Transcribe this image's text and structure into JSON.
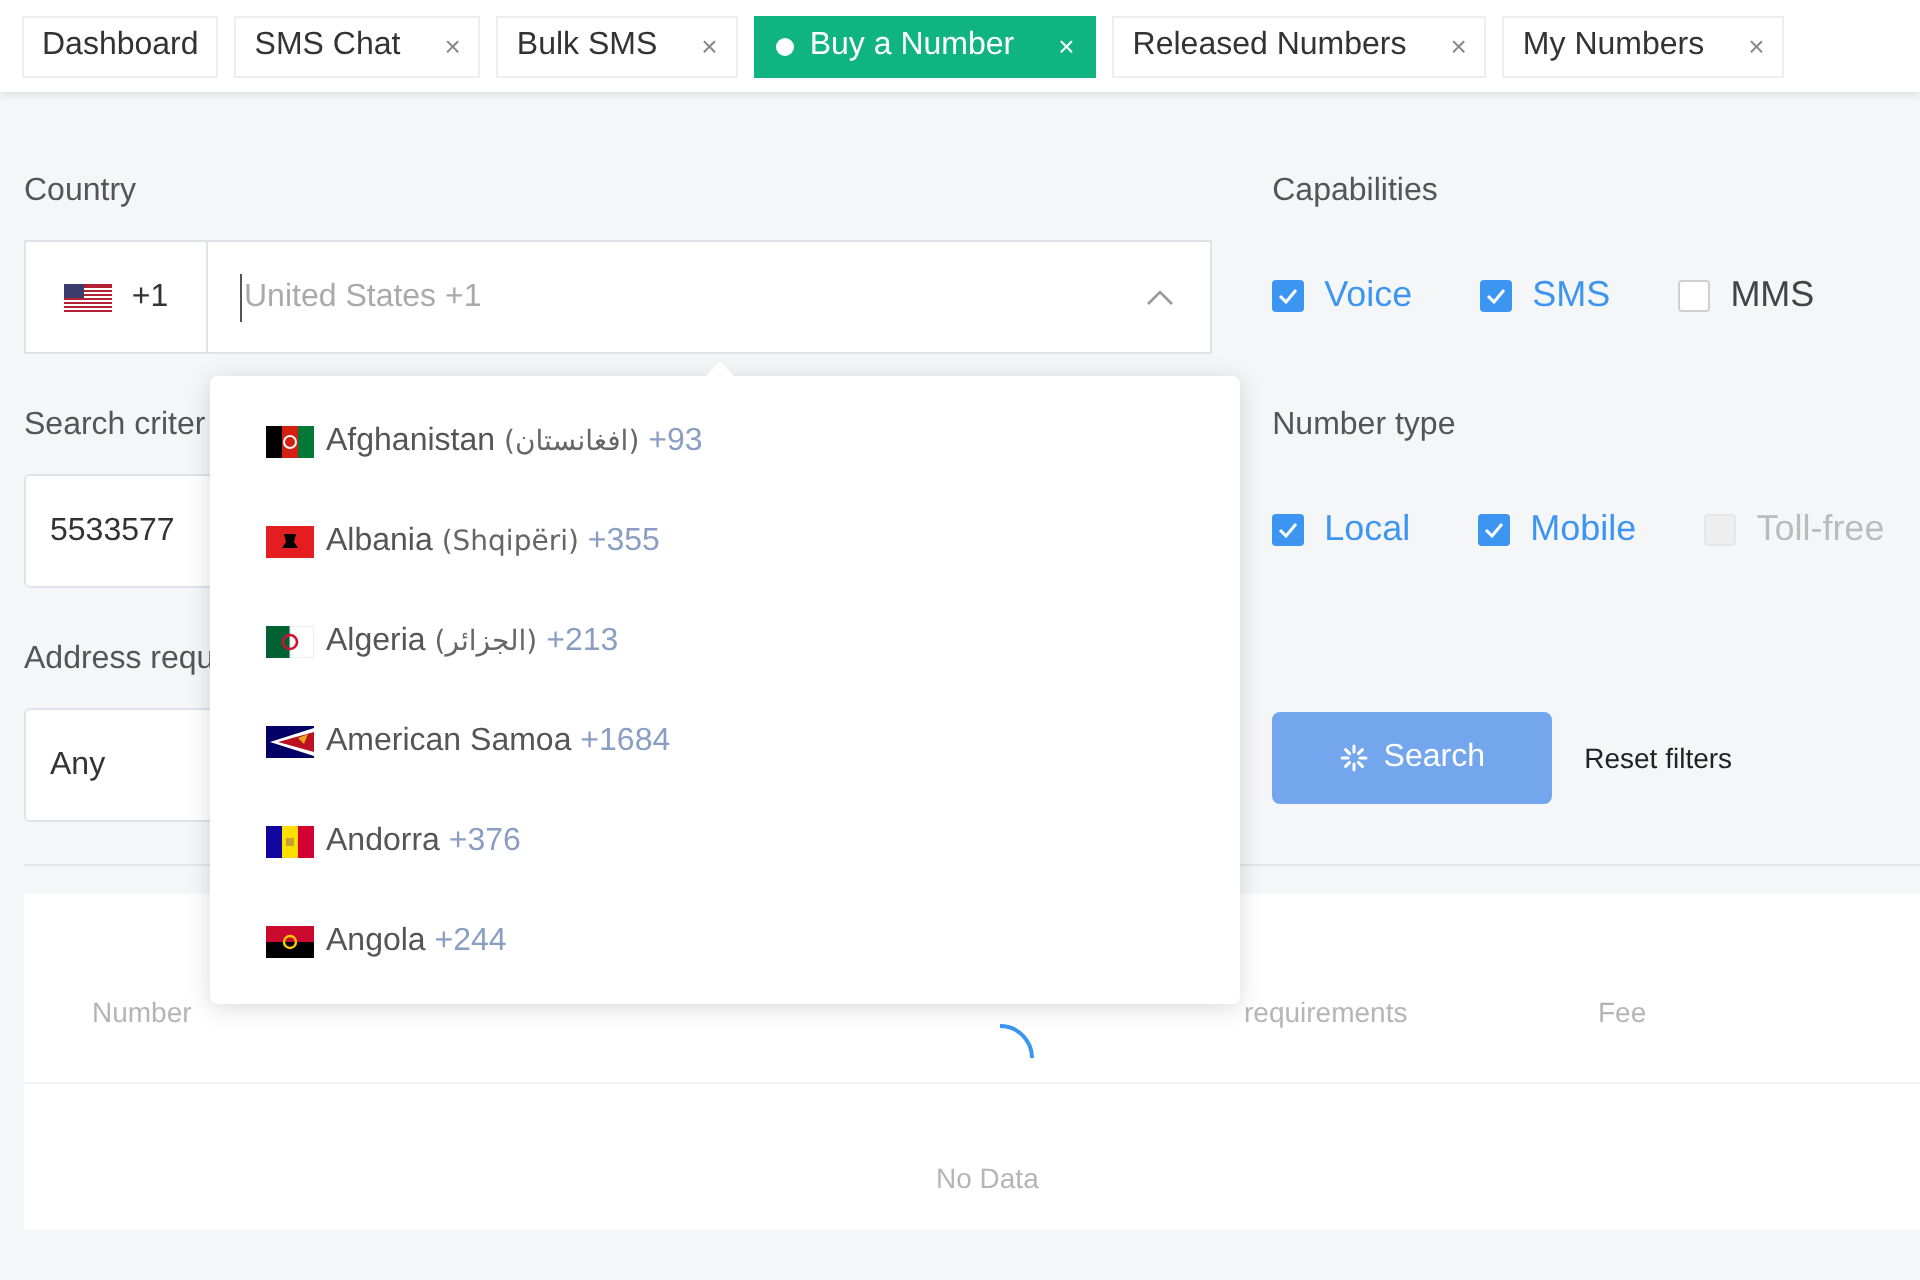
{
  "tabs": [
    {
      "label": "Dashboard",
      "selected": false,
      "closable": false
    },
    {
      "label": "SMS Chat",
      "selected": false,
      "closable": true
    },
    {
      "label": "Bulk SMS",
      "selected": false,
      "closable": true
    },
    {
      "label": "Buy a Number",
      "selected": true,
      "closable": true
    },
    {
      "label": "Released Numbers",
      "selected": false,
      "closable": true
    },
    {
      "label": "My Numbers",
      "selected": false,
      "closable": true
    }
  ],
  "close_glyph": "×",
  "country": {
    "label": "Country",
    "dial_code": "+1",
    "placeholder": "United States +1",
    "expanded": true,
    "options": [
      {
        "name": "Afghanistan",
        "native": "(افغانستان)",
        "code": "+93",
        "kind": "af"
      },
      {
        "name": "Albania",
        "native": "(Shqipëri)",
        "code": "+355",
        "kind": "al"
      },
      {
        "name": "Algeria",
        "native": "(الجزائر)",
        "code": "+213",
        "kind": "dz"
      },
      {
        "name": "American Samoa",
        "code": "+1684",
        "kind": "as"
      },
      {
        "name": "Andorra",
        "code": "+376",
        "kind": "ad"
      },
      {
        "name": "Angola",
        "code": "+244",
        "kind": "ao"
      }
    ]
  },
  "search_criteria": {
    "label": "Search criter",
    "value": "5533577"
  },
  "address_requirements": {
    "label": "Address requ",
    "value": "Any"
  },
  "capabilities": {
    "label": "Capabilities",
    "options": [
      {
        "label": "Voice",
        "checked": true,
        "disabled": false
      },
      {
        "label": "SMS",
        "checked": true,
        "disabled": false
      },
      {
        "label": "MMS",
        "checked": false,
        "disabled": false
      }
    ]
  },
  "number_type": {
    "label": "Number type",
    "options": [
      {
        "label": "Local",
        "checked": true,
        "disabled": false
      },
      {
        "label": "Mobile",
        "checked": true,
        "disabled": false
      },
      {
        "label": "Toll-free",
        "checked": false,
        "disabled": true
      }
    ]
  },
  "search_button": {
    "label": "Search",
    "loading": true
  },
  "reset_button": "Reset filters",
  "table": {
    "loading": true,
    "columns": [
      "Number",
      "requirements",
      "Fee"
    ],
    "empty_text": "No Data"
  }
}
